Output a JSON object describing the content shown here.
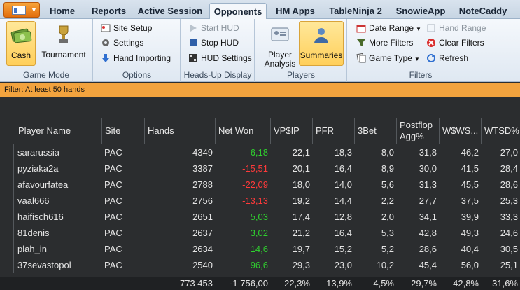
{
  "tabs": [
    {
      "label": "Home",
      "active": false
    },
    {
      "label": "Reports",
      "active": false
    },
    {
      "label": "Active Session",
      "active": false
    },
    {
      "label": "Opponents",
      "active": true
    },
    {
      "label": "HM Apps",
      "active": false
    },
    {
      "label": "TableNinja 2",
      "active": false
    },
    {
      "label": "SnowieApp",
      "active": false
    },
    {
      "label": "NoteCaddy",
      "active": false
    }
  ],
  "ribbon": {
    "game_mode": {
      "label": "Game Mode",
      "cash": "Cash",
      "tournament": "Tournament"
    },
    "options": {
      "label": "Options",
      "site_setup": "Site Setup",
      "settings": "Settings",
      "hand_importing": "Hand Importing"
    },
    "hud": {
      "label": "Heads-Up Display",
      "start_hud": "Start HUD",
      "stop_hud": "Stop HUD",
      "hud_settings": "HUD Settings"
    },
    "players": {
      "label": "Players",
      "player_analysis": "Player Analysis",
      "summaries": "Summaries"
    },
    "filters": {
      "label": "Filters",
      "date_range": "Date Range",
      "more_filters": "More Filters",
      "game_type": "Game Type",
      "hand_range": "Hand Range",
      "clear_filters": "Clear Filters",
      "refresh": "Refresh"
    }
  },
  "filter_status": "Filter: At least 50 hands",
  "colors": {
    "accent_orange": "#f2a33e",
    "positive": "#2fd12f",
    "negative": "#ff3a3a",
    "grid_bg": "#2b2d2f"
  },
  "table": {
    "columns": [
      "Player Name",
      "Site",
      "Hands",
      "Net Won",
      "VP$IP",
      "PFR",
      "3Bet",
      "Postflop Agg%",
      "W$WS...",
      "WTSD%"
    ],
    "rows": [
      {
        "name": "sararussia",
        "site": "PAC",
        "hands": "4349",
        "net": "6,18",
        "net_sign": "pos",
        "vpip": "22,1",
        "pfr": "18,3",
        "threebet": "8,0",
        "agg": "31,8",
        "wws": "46,2",
        "wtsd": "27,0"
      },
      {
        "name": "pyziaka2a",
        "site": "PAC",
        "hands": "3387",
        "net": "-15,51",
        "net_sign": "neg",
        "vpip": "20,1",
        "pfr": "16,4",
        "threebet": "8,9",
        "agg": "30,0",
        "wws": "41,5",
        "wtsd": "28,4"
      },
      {
        "name": "afavourfatea",
        "site": "PAC",
        "hands": "2788",
        "net": "-22,09",
        "net_sign": "neg",
        "vpip": "18,0",
        "pfr": "14,0",
        "threebet": "5,6",
        "agg": "31,3",
        "wws": "45,5",
        "wtsd": "28,6"
      },
      {
        "name": "vaal666",
        "site": "PAC",
        "hands": "2756",
        "net": "-13,13",
        "net_sign": "neg",
        "vpip": "19,2",
        "pfr": "14,4",
        "threebet": "2,2",
        "agg": "27,7",
        "wws": "37,5",
        "wtsd": "25,3"
      },
      {
        "name": "haifisch616",
        "site": "PAC",
        "hands": "2651",
        "net": "5,03",
        "net_sign": "pos",
        "vpip": "17,4",
        "pfr": "12,8",
        "threebet": "2,0",
        "agg": "34,1",
        "wws": "39,9",
        "wtsd": "33,3"
      },
      {
        "name": "81denis",
        "site": "PAC",
        "hands": "2637",
        "net": "3,02",
        "net_sign": "pos",
        "vpip": "21,2",
        "pfr": "16,4",
        "threebet": "5,3",
        "agg": "42,8",
        "wws": "49,3",
        "wtsd": "24,6"
      },
      {
        "name": "plah_in",
        "site": "PAC",
        "hands": "2634",
        "net": "14,6",
        "net_sign": "pos",
        "vpip": "19,7",
        "pfr": "15,2",
        "threebet": "5,2",
        "agg": "28,6",
        "wws": "40,4",
        "wtsd": "30,5"
      },
      {
        "name": "37sevastopol",
        "site": "PAC",
        "hands": "2540",
        "net": "96,6",
        "net_sign": "pos",
        "vpip": "29,3",
        "pfr": "23,0",
        "threebet": "10,2",
        "agg": "45,4",
        "wws": "56,0",
        "wtsd": "25,1"
      }
    ],
    "totals": {
      "hands": "773 453",
      "net": "-1 756,00",
      "vpip": "22,3%",
      "pfr": "13,9%",
      "threebet": "4,5%",
      "agg": "29,7%",
      "wws": "42,8%",
      "wtsd": "31,6%"
    }
  }
}
